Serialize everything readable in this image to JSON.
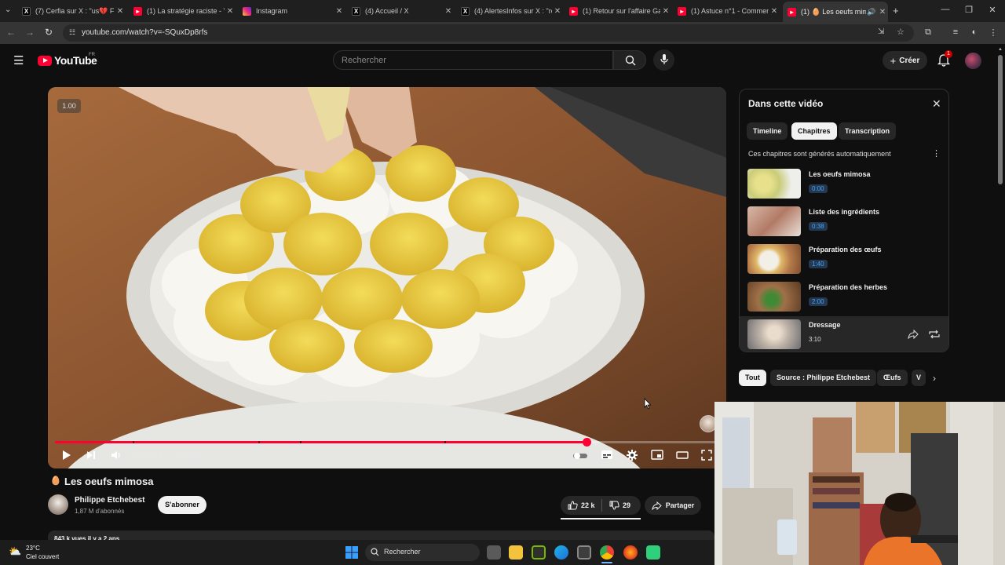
{
  "browser": {
    "tabs": [
      {
        "title": "(7) Cerfia sur X : \"us💔 FL",
        "icon": "x-icon",
        "active": false
      },
      {
        "title": "(1) La stratégie raciste - Y",
        "icon": "youtube-icon",
        "active": false
      },
      {
        "title": "Instagram",
        "icon": "instagram-icon",
        "active": false
      },
      {
        "title": "(4) Accueil / X",
        "icon": "x-icon",
        "active": false
      },
      {
        "title": "(4) AlertesInfos sur X : \"re",
        "icon": "x-icon",
        "active": false
      },
      {
        "title": "(1) Retour sur l'affaire Gal",
        "icon": "youtube-icon",
        "active": false
      },
      {
        "title": "(1) Astuce n°1 - Commen",
        "icon": "youtube-icon",
        "active": false
      },
      {
        "title": "(1) 🥚 Les oeufs mim",
        "icon": "youtube-icon",
        "active": true
      }
    ],
    "url": "youtube.com/watch?v=-SQuxDp8rfs"
  },
  "youtube": {
    "logo_text": "YouTube",
    "country": "FR",
    "search_placeholder": "Rechercher",
    "create_label": "Créer",
    "notification_count": "1"
  },
  "video": {
    "speed_badge": "1.00",
    "time": "4:25 / 5:22",
    "current_chapter": "Dressage",
    "progress": 0.8,
    "chapter_markers": [
      0.1174,
      0.3063,
      0.3693,
      0.5865
    ],
    "title_emoji": "🥚",
    "title": "Les oeufs mimosa",
    "channel": "Philippe Etchebest",
    "subscribers": "1,87 M d'abonnés",
    "subscribe_label": "S'abonner",
    "likes": "22 k",
    "dislikes": "29",
    "share_label": "Partager",
    "description_preview": "843 k vues  il y a 2 ans"
  },
  "chapters_panel": {
    "title": "Dans cette vidéo",
    "tabs": [
      {
        "label": "Timeline",
        "selected": false
      },
      {
        "label": "Chapitres",
        "selected": true
      },
      {
        "label": "Transcription",
        "selected": false
      }
    ],
    "note": "Ces chapitres sont générés automatiquement",
    "chapters": [
      {
        "name": "Les oeufs mimosa",
        "time": "0:00"
      },
      {
        "name": "Liste des ingrédients",
        "time": "0:38"
      },
      {
        "name": "Préparation des œufs",
        "time": "1:40"
      },
      {
        "name": "Préparation des herbes",
        "time": "2:00"
      },
      {
        "name": "Dressage",
        "time": "3:10"
      }
    ]
  },
  "chips": [
    {
      "label": "Tout",
      "selected": true
    },
    {
      "label": "Source : Philippe Etchebest",
      "selected": false
    },
    {
      "label": "Œufs",
      "selected": false
    },
    {
      "label": "V",
      "selected": false
    }
  ],
  "taskbar": {
    "temperature": "23°C",
    "weather": "Ciel couvert",
    "search_placeholder": "Rechercher"
  },
  "colors": {
    "accent_red": "#ff0033",
    "background": "#0f0f0f",
    "chapter_time_blue": "#3ea6ff"
  }
}
